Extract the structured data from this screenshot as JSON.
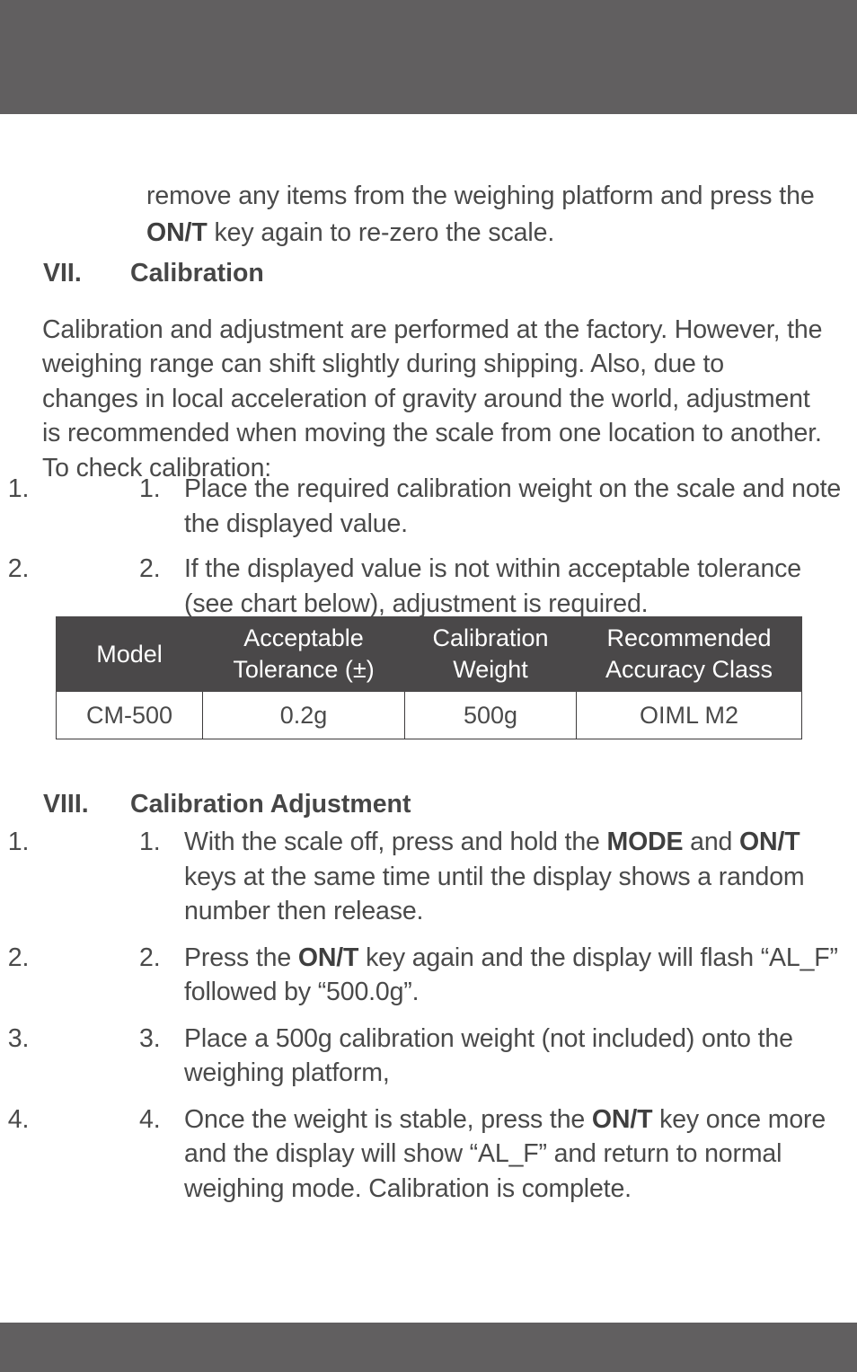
{
  "page": {
    "header_band_color": "#615f60",
    "footer_band_color": "#615f60",
    "text_color": "#4a4a4a",
    "background_color": "#ffffff"
  },
  "continuation_paragraph": {
    "before_bold": "remove any items from the weighing platform and press the ",
    "bold": "ON/T",
    "after_bold": " key again to re-zero the scale."
  },
  "sections": {
    "calibration": {
      "numeral": "VII.",
      "title": "Calibration",
      "lead": "Calibration and adjustment are performed at the factory. However, the weighing range can shift slightly during shipping. Also, due to changes in local acceleration of gravity around the world, adjustment is recommended when moving the scale from one location to another. To check calibration:",
      "steps": [
        {
          "marker": "1.",
          "text": "Place the required calibration weight on the scale and note the displayed value."
        },
        {
          "marker": "2.",
          "text": "If the displayed value is not within acceptable tolerance (see chart below), adjustment is required."
        }
      ]
    },
    "calibration_adjustment": {
      "numeral": "VIII.",
      "title": "Calibration Adjustment",
      "steps": [
        {
          "marker": "1.",
          "part1": "With the scale off, press and hold the ",
          "bold1": "MODE",
          "part2": " and ",
          "bold2": "ON/T",
          "part3": " keys at the same time until the display shows a random number then release."
        },
        {
          "marker": "2.",
          "part1": "Press the ",
          "bold1": "ON/T",
          "part2": " key again and the display will flash “AL_F” followed by “500.0g”."
        },
        {
          "marker": "3.",
          "part1": "Place a 500g calibration weight (not included) onto the weighing platform,"
        },
        {
          "marker": "4.",
          "part1": "Once the weight is stable, press the ",
          "bold1": "ON/T",
          "part2": " key once more and the display will show “AL_F” and return to normal weighing mode. Calibration is complete."
        }
      ]
    }
  },
  "spec_table": {
    "header_background": "#4a4849",
    "header_text_color": "#ffffff",
    "border_color": "#3d3b3c",
    "columns": [
      "Model",
      "Acceptable Tolerance (±)",
      "Calibration Weight",
      "Recommended Accuracy Class"
    ],
    "rows": [
      {
        "model": "CM-500",
        "acceptable_tolerance": "0.2g",
        "calibration_weight": "500g",
        "recommended_accuracy_class": "OIML M2"
      }
    ]
  }
}
